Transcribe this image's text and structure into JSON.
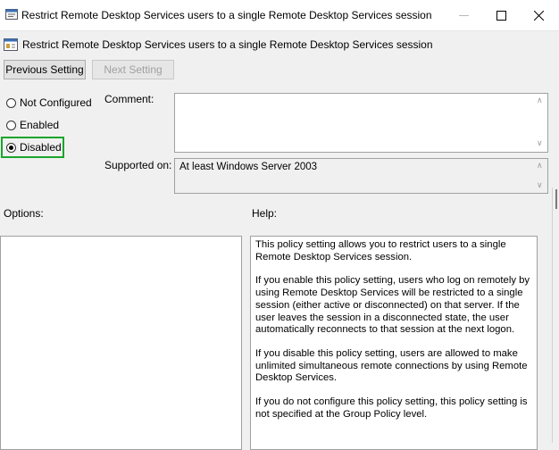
{
  "window": {
    "title": "Restrict Remote Desktop Services users to a single Remote Desktop Services session"
  },
  "header": {
    "title": "Restrict Remote Desktop Services users to a single Remote Desktop Services session"
  },
  "nav": {
    "prev_label": "Previous Setting",
    "next_label": "Next Setting"
  },
  "state": {
    "options": [
      "Not Configured",
      "Enabled",
      "Disabled"
    ],
    "selected": "Disabled",
    "highlight_color": "#1aa52b"
  },
  "comment": {
    "label": "Comment:",
    "value": ""
  },
  "supported": {
    "label": "Supported on:",
    "value": "At least Windows Server 2003"
  },
  "options_label": "Options:",
  "help": {
    "label": "Help:",
    "paragraphs": [
      "This policy setting allows you to restrict users to a single Remote Desktop Services session.",
      "If you enable this policy setting, users who log on remotely by using Remote Desktop Services will be restricted to a single session (either active or disconnected) on that server. If the user leaves the session in a disconnected state, the user automatically reconnects to that session at the next logon.",
      "If you disable this policy setting, users are allowed to make unlimited simultaneous remote connections by using Remote Desktop Services.",
      "If you do not configure this policy setting,  this policy setting is not specified at the Group Policy level."
    ]
  }
}
